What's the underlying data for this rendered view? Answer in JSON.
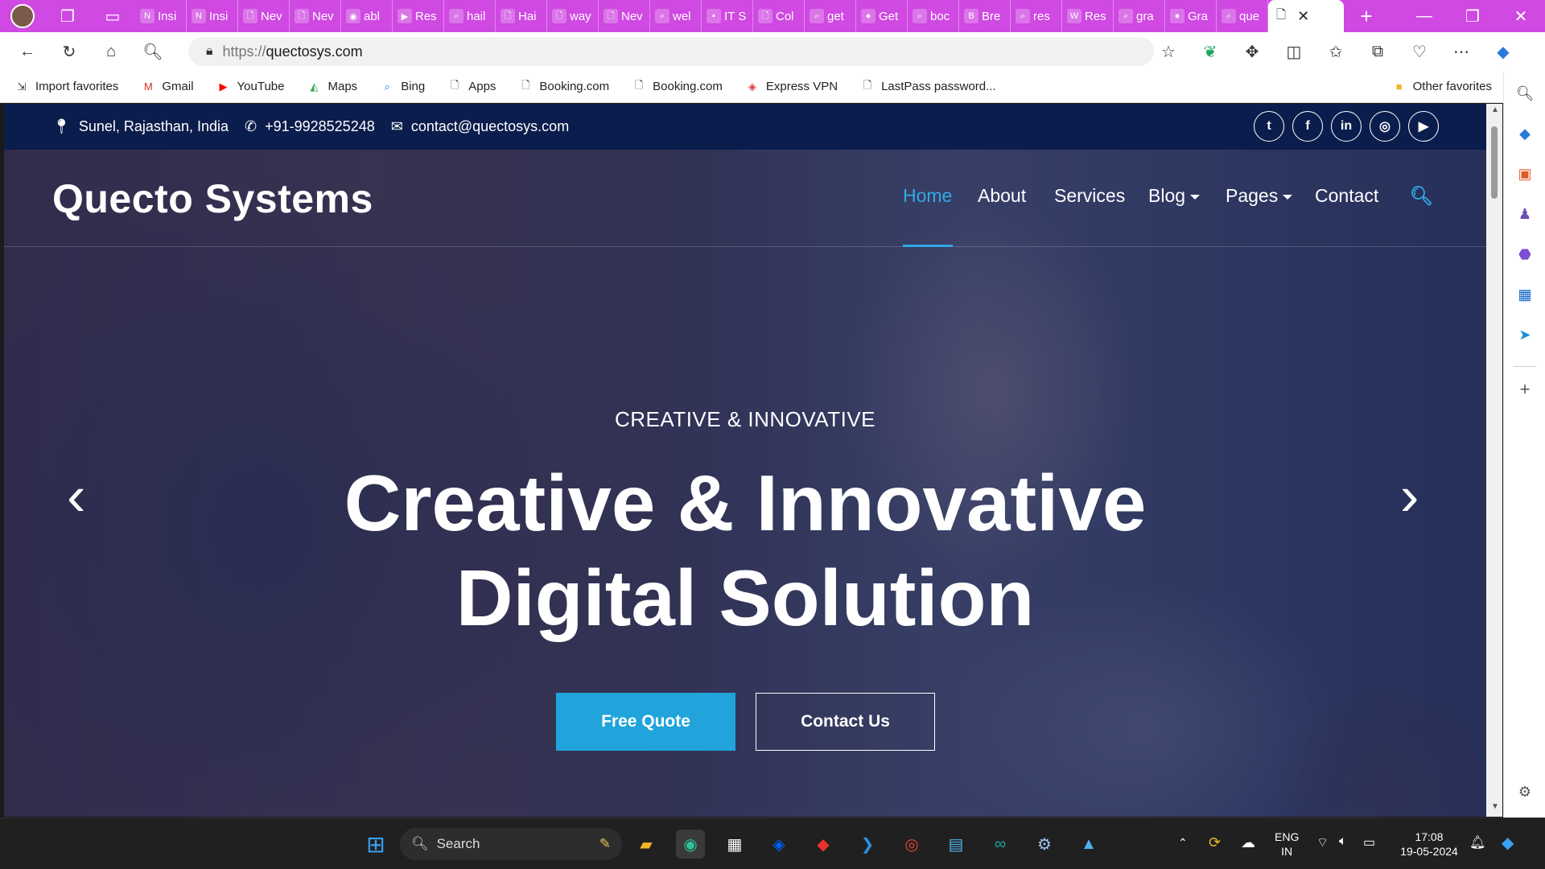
{
  "browser": {
    "tabs": [
      {
        "label": "Insi",
        "icon": "notion-icon"
      },
      {
        "label": "Insi",
        "icon": "notion-icon"
      },
      {
        "label": "Nev",
        "icon": "page-icon"
      },
      {
        "label": "Nev",
        "icon": "page-icon"
      },
      {
        "label": "abl",
        "icon": "github-icon"
      },
      {
        "label": "Res",
        "icon": "youtube-icon"
      },
      {
        "label": "hail",
        "icon": "search-icon"
      },
      {
        "label": "Hai",
        "icon": "page-icon"
      },
      {
        "label": "way",
        "icon": "page-icon"
      },
      {
        "label": "Nev",
        "icon": "page-icon"
      },
      {
        "label": "wel",
        "icon": "search-icon"
      },
      {
        "label": "IT S",
        "icon": "site-icon"
      },
      {
        "label": "Col",
        "icon": "page-icon"
      },
      {
        "label": "get",
        "icon": "search-icon"
      },
      {
        "label": "Get",
        "icon": "globe-icon"
      },
      {
        "label": "boc",
        "icon": "search-icon"
      },
      {
        "label": "Bre",
        "icon": "b-icon"
      },
      {
        "label": "res",
        "icon": "search-icon"
      },
      {
        "label": "Res",
        "icon": "w-icon"
      },
      {
        "label": "gra",
        "icon": "search-icon"
      },
      {
        "label": "Gra",
        "icon": "globe-icon"
      },
      {
        "label": "que",
        "icon": "search-icon"
      }
    ],
    "url_scheme": "https://",
    "url_host": "quectosys.com",
    "favorites": [
      {
        "label": "Import favorites",
        "icon": "import-icon"
      },
      {
        "label": "Gmail",
        "icon": "gmail-icon"
      },
      {
        "label": "YouTube",
        "icon": "youtube-icon"
      },
      {
        "label": "Maps",
        "icon": "maps-icon"
      },
      {
        "label": "Bing",
        "icon": "search-icon"
      },
      {
        "label": "Apps",
        "icon": "page-icon"
      },
      {
        "label": "Booking.com",
        "icon": "page-icon"
      },
      {
        "label": "Booking.com",
        "icon": "page-icon"
      },
      {
        "label": "Express VPN",
        "icon": "vpn-icon"
      },
      {
        "label": "LastPass password...",
        "icon": "page-icon"
      }
    ],
    "other_favorites": "Other favorites"
  },
  "site": {
    "topbar": {
      "location": "Sunel, Rajasthan, India",
      "phone": "+91-9928525248",
      "email": "contact@quectosys.com",
      "socials": [
        "twitter-icon",
        "facebook-icon",
        "linkedin-icon",
        "instagram-icon",
        "youtube-icon"
      ]
    },
    "brand": "Quecto Systems",
    "nav": {
      "home": "Home",
      "about": "About",
      "services": "Services",
      "blog": "Blog",
      "pages": "Pages",
      "contact": "Contact"
    },
    "hero": {
      "eyebrow": "CREATIVE & INNOVATIVE",
      "headline_line1": "Creative & Innovative",
      "headline_line2": "Digital Solution",
      "primary_cta": "Free Quote",
      "secondary_cta": "Contact Us"
    },
    "colors": {
      "accent": "#20a4db",
      "topbar": "#0b1d4c",
      "overlay": "#18245c"
    }
  },
  "taskbar": {
    "search_placeholder": "Search",
    "language_line1": "ENG",
    "language_line2": "IN",
    "time": "17:08",
    "date": "19-05-2024"
  }
}
